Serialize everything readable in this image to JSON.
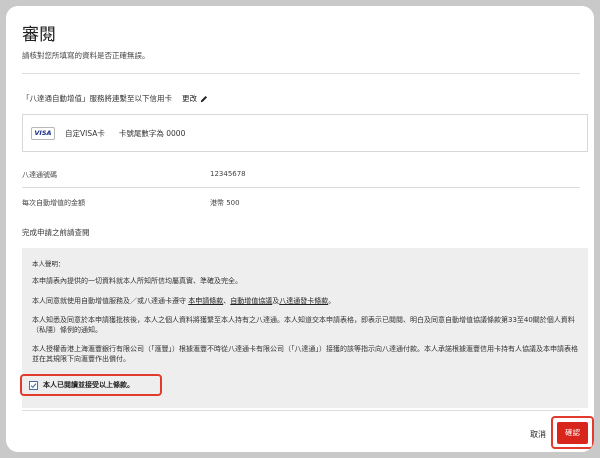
{
  "page": {
    "title": "審閱",
    "subtitle": "請核對您所填寫的資料是否正確無誤。"
  },
  "linked_card": {
    "heading": "「八達通自動增值」服務將連繫至以下信用卡",
    "change_label": "更改",
    "brand": "VISA",
    "card_name": "自定VISA卡",
    "last4": "卡號尾數字為 0000"
  },
  "fields": [
    {
      "label": "八達通號碼",
      "value": "12345678"
    },
    {
      "label": "每次自動增值的金額",
      "value": "港幣 500"
    }
  ],
  "terms": {
    "heading": "完成申請之前請查閱",
    "intro": "本人聲明：",
    "p1": "本申請表內提供的一切資料就本人所知所信均屬真實、準確及完全。",
    "p2_prefix": "本人同意就使用自動增值服務及／或八達通卡遵守",
    "p2_link1": "本申請條款",
    "p2_sep1": "、",
    "p2_link2": "自動增值協議",
    "p2_sep2": "及",
    "p2_link3": "八達通發卡條款",
    "p2_suffix": "。",
    "p3": "本人知悉及同意於本申請獲批核後，本人之個人資料將獲繫至本人持有之八達通。本人知道交本申請表格，即表示已閱閱、明白及同意自動增值協議條款第33至40關於個人資料（私隱）條例的通知。",
    "p4": "本人授權香港上海滙豐銀行有限公司（「滙豐」）根據滙豐不時從八達通卡有限公司（「八達通」）接獲的該等指示向八達通付款。本人承諾根據滙豐信用卡持有人協議及本申請表格並在其規限下向滙豐作出償付。",
    "agree_label": "本人已閱讀並接受以上條款。"
  },
  "actions": {
    "cancel": "取消",
    "confirm": "確認"
  }
}
